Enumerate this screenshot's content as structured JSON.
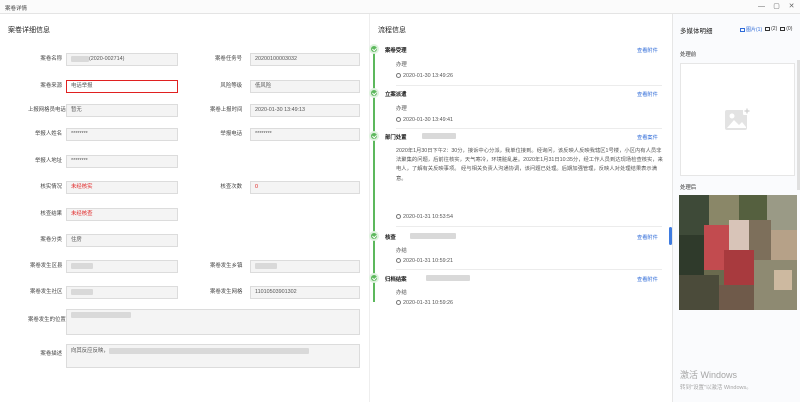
{
  "window": {
    "title": "案卷详情",
    "controls": [
      "—",
      "▢",
      "✕"
    ]
  },
  "left": {
    "section_title": "案卷详细信息",
    "fields": {
      "case_name": {
        "label": "案卷名称",
        "value": "(2020-002714)"
      },
      "task_no": {
        "label": "案卷任务号",
        "value": "20200100003032"
      },
      "source": {
        "label": "案卷来源",
        "value": "电话举报"
      },
      "risk": {
        "label": "风险等级",
        "value": "低风险"
      },
      "reporter_phone_upstream": {
        "label": "上报网格员电话",
        "value": "暂无"
      },
      "report_time": {
        "label": "案卷上报时间",
        "value": "2020-01-30 13:49:13"
      },
      "reporter_name": {
        "label": "举报人姓名",
        "value": "********"
      },
      "reporter_phone": {
        "label": "举报电话",
        "value": "********"
      },
      "reporter_addr": {
        "label": "举报人地址",
        "value": "********"
      },
      "verify_status": {
        "label": "核实情况",
        "value": "未经核实"
      },
      "verify_count": {
        "label": "核查次数",
        "value": "0"
      },
      "check_result": {
        "label": "核查结果",
        "value": "未经核查"
      },
      "case_type": {
        "label": "案卷分类",
        "value": "住房"
      },
      "district": {
        "label": "案卷发生区县",
        "value": ""
      },
      "town": {
        "label": "案卷发生乡镇",
        "value": ""
      },
      "community": {
        "label": "案卷发生社区",
        "value": ""
      },
      "grid": {
        "label": "案卷发生网格",
        "value": "11010503901302"
      },
      "location": {
        "label": "案卷发生的位置",
        "value": ""
      },
      "description": {
        "label": "案卷描述",
        "value": "向其反应反映，"
      }
    }
  },
  "flow": {
    "section_title": "流程信息",
    "steps": [
      {
        "title": "案卷受理",
        "status": "办理",
        "time": "2020-01-30 13:49:26",
        "link": "查看附件"
      },
      {
        "title": "立案派遣",
        "status": "办理",
        "time": "2020-01-30 13:49:41",
        "link": "查看附件"
      },
      {
        "title": "部门处置",
        "status": "",
        "time": "2020-01-31 10:53:54",
        "link": "查看案件",
        "description": "2020年1月30日下午2：30分，接诉中心分派，我单位接到。经询问，该反映人反映我辖区1号楼，小区内有人员非法聚集的问题，后前往核实，天气寒冷，环境脏乱差。2020年1月31日10:35分，经工作人员到达现场检查核实，来电人，了解有关反映事项。 经与相关负责人沟通协调，该问题已处理。后期加强管理，反映人对处理结果表示满意。"
      },
      {
        "title": "核查",
        "status": "办结",
        "time": "2020-01-31 10:59:21",
        "link": "查看附件"
      },
      {
        "title": "归档结案",
        "status": "办结",
        "time": "2020-01-31 10:59:26",
        "link": "查看附件"
      }
    ]
  },
  "media": {
    "section_title": "多媒体明细",
    "tabs": [
      "图片(1)",
      "(2)",
      "(0)"
    ],
    "before_label": "处理前",
    "after_label": "处理后"
  },
  "watermark": {
    "line1": "激活 Windows",
    "line2": "转到\"设置\"以激活 Windows。"
  }
}
